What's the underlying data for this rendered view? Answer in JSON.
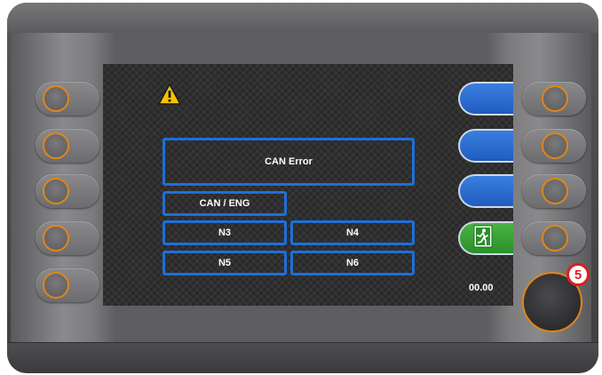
{
  "screen": {
    "error_title": "CAN Error",
    "source_label": "CAN / ENG",
    "nodes": [
      "N3",
      "N4",
      "N5",
      "N6"
    ],
    "readout_value": "00.00"
  },
  "indicators": {
    "warning_icon": "warning-triangle-icon",
    "exit_icon": "emergency-exit-icon",
    "knob_badge": "5"
  },
  "colors": {
    "box_border": "#1e6fd9",
    "ring_accent": "#e0861a",
    "exit_green": "#2a8f2a",
    "softkey_blue": "#1f5dbf",
    "badge_red": "#d92020"
  }
}
